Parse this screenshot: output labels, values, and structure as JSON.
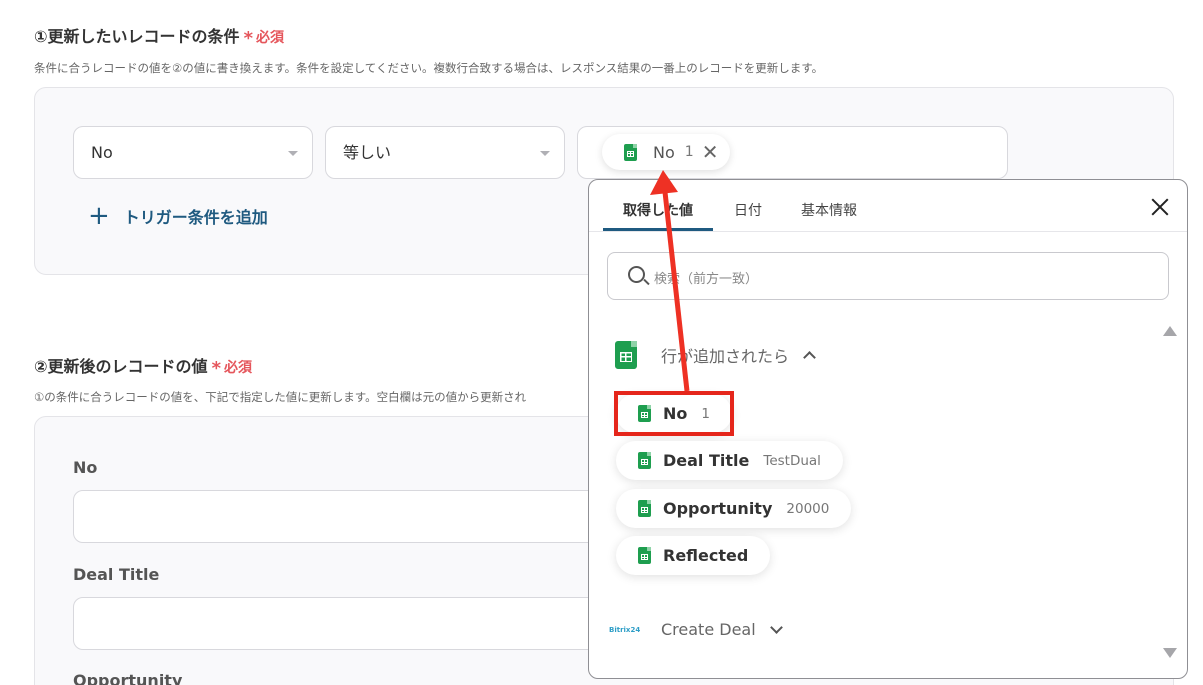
{
  "section1": {
    "title": "①更新したいレコードの条件",
    "required": "必須",
    "description": "条件に合うレコードの値を②の値に書き換えます。条件を設定してください。複数行合致する場合は、レスポンス結果の一番上のレコードを更新します。",
    "condition": {
      "field_select": "No",
      "operator_select": "等しい",
      "value_chip": {
        "name": "No",
        "value": "1"
      }
    },
    "add_condition_label": "トリガー条件を追加"
  },
  "section2": {
    "title": "②更新後のレコードの値",
    "required": "必須",
    "description": "①の条件に合うレコードの値を、下記で指定した値に更新します。空白欄は元の値から更新され",
    "fields": [
      {
        "label": "No",
        "value": ""
      },
      {
        "label": "Deal Title",
        "value": ""
      },
      {
        "label": "Opportunity",
        "value": ""
      }
    ]
  },
  "popup": {
    "tabs": [
      "取得した値",
      "日付",
      "基本情報"
    ],
    "active_tab": 0,
    "search_placeholder": "検索（前方一致）",
    "groups": [
      {
        "title": "行が追加されたら",
        "expanded": true,
        "items": [
          {
            "name": "No",
            "value": "1"
          },
          {
            "name": "Deal Title",
            "value": "TestDual"
          },
          {
            "name": "Opportunity",
            "value": "20000"
          },
          {
            "name": "Reflected",
            "value": ""
          }
        ]
      },
      {
        "title": "Create Deal",
        "logo_text": "Bitrix24",
        "expanded": false
      }
    ]
  },
  "colors": {
    "required": "#e5565c",
    "link": "#1f5a80",
    "highlight": "#e5261b",
    "sheets_green": "#1e9e4f"
  }
}
